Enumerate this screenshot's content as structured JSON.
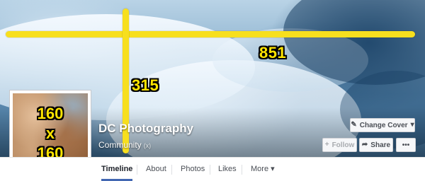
{
  "page": {
    "name": "DC Photography",
    "category": "Community",
    "category_meta": "(x)"
  },
  "cover": {
    "change_cover_label": "Change Cover",
    "change_cover_icon": "pencil-icon",
    "width_annotation": "851",
    "height_annotation": "315"
  },
  "profile_picture": {
    "annotation_width": "160",
    "annotation_x": "x",
    "annotation_height": "160"
  },
  "actions": {
    "follow_label": "Follow",
    "follow_icon": "plus-icon",
    "share_label": "Share",
    "share_icon": "share-arrow-icon",
    "more_label": "•••"
  },
  "tabs": [
    {
      "label": "Timeline",
      "active": true
    },
    {
      "label": "About"
    },
    {
      "label": "Photos"
    },
    {
      "label": "Likes"
    },
    {
      "label": "More ▾"
    }
  ],
  "colors": {
    "annotation": "#ffe400",
    "accent": "#4267b2"
  }
}
